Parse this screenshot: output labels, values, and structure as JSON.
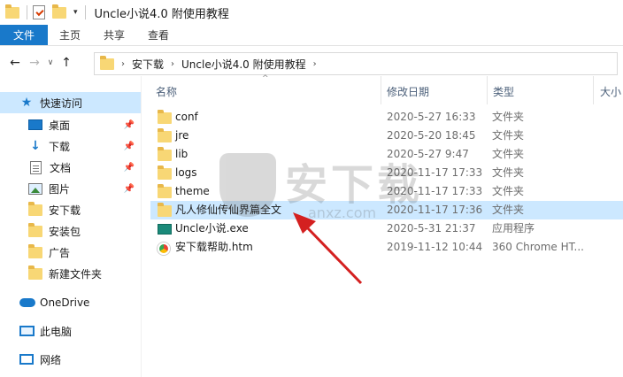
{
  "window": {
    "title": "Uncle小说4.0 附使用教程",
    "dropdown_glyph": "▾"
  },
  "ribbon": {
    "tabs": [
      "文件",
      "主页",
      "共享",
      "查看"
    ]
  },
  "address": {
    "back_glyph": "←",
    "forward_glyph": "→",
    "recent_glyph": "∨",
    "up_glyph": "↑",
    "sep_glyph": "›",
    "crumbs": [
      "安下载",
      "Uncle小说4.0 附使用教程"
    ]
  },
  "nav": {
    "pin_glyph": "📌",
    "quick_access": "快速访问",
    "items": [
      {
        "label": "桌面",
        "icon": "desktop-icon",
        "pinned": true
      },
      {
        "label": "下载",
        "icon": "download-icon",
        "pinned": true
      },
      {
        "label": "文档",
        "icon": "document-icon",
        "pinned": true
      },
      {
        "label": "图片",
        "icon": "picture-icon",
        "pinned": true
      },
      {
        "label": "安下载",
        "icon": "folder-icon",
        "pinned": false
      },
      {
        "label": "安装包",
        "icon": "folder-icon",
        "pinned": false
      },
      {
        "label": "广告",
        "icon": "folder-icon",
        "pinned": false
      },
      {
        "label": "新建文件夹",
        "icon": "folder-icon",
        "pinned": false
      }
    ],
    "onedrive": "OneDrive",
    "this_pc": "此电脑",
    "network": "网络"
  },
  "columns": {
    "name": "名称",
    "date": "修改日期",
    "type": "类型",
    "size": "大小",
    "sort_glyph": "^"
  },
  "files": [
    {
      "name": "conf",
      "date": "2020-5-27 16:33",
      "type": "文件夹",
      "icon": "folder-icon"
    },
    {
      "name": "jre",
      "date": "2020-5-20 18:45",
      "type": "文件夹",
      "icon": "folder-icon"
    },
    {
      "name": "lib",
      "date": "2020-5-27 9:47",
      "type": "文件夹",
      "icon": "folder-icon"
    },
    {
      "name": "logs",
      "date": "2020-11-17 17:33",
      "type": "文件夹",
      "icon": "folder-icon"
    },
    {
      "name": "theme",
      "date": "2020-11-17 17:33",
      "type": "文件夹",
      "icon": "folder-icon"
    },
    {
      "name": "凡人修仙传仙界篇全文",
      "date": "2020-11-17 17:36",
      "type": "文件夹",
      "icon": "folder-icon",
      "selected": true
    },
    {
      "name": "Uncle小说.exe",
      "date": "2020-5-31 21:37",
      "type": "应用程序",
      "icon": "exe-icon"
    },
    {
      "name": "安下载帮助.htm",
      "date": "2019-11-12 10:44",
      "type": "360 Chrome HT...",
      "icon": "chrome-html-icon"
    }
  ],
  "watermark": {
    "text": "安下载",
    "url": "anxz.com"
  },
  "colors": {
    "file_tab": "#1979ca",
    "selection": "#cce8ff",
    "arrow": "#d42020"
  }
}
